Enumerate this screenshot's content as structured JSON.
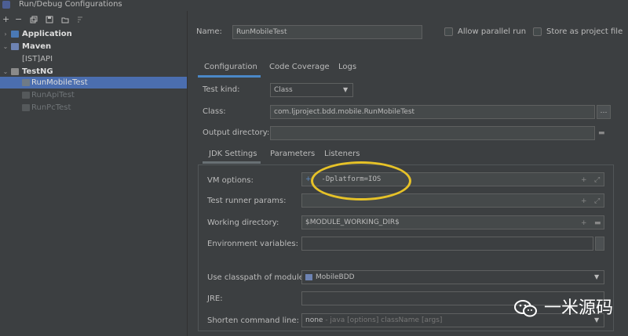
{
  "window": {
    "title": "Run/Debug Configurations"
  },
  "toolbar": {
    "add": "+",
    "remove": "−"
  },
  "tree": {
    "items": [
      {
        "label": "Application",
        "icon": "application-icon",
        "arrow": "›"
      },
      {
        "label": "Maven",
        "icon": "maven-icon",
        "arrow": "⌄"
      },
      {
        "label": "[IST]API",
        "icon": "maven-config-icon",
        "arrow": ""
      },
      {
        "label": "TestNG",
        "icon": "testng-icon",
        "arrow": "⌄"
      },
      {
        "label": "RunMobileTest",
        "icon": "testng-config-icon",
        "arrow": ""
      },
      {
        "label": "RunApiTest",
        "icon": "testng-config-icon",
        "arrow": ""
      },
      {
        "label": "RunPcTest",
        "icon": "testng-config-icon",
        "arrow": ""
      }
    ]
  },
  "form": {
    "name_label": "Name:",
    "name_value": "RunMobileTest",
    "allow_parallel": "Allow parallel run",
    "store_as_file": "Store as project file",
    "tabs": [
      "Configuration",
      "Code Coverage",
      "Logs"
    ],
    "test_kind_label": "Test kind:",
    "test_kind_value": "Class",
    "class_label": "Class:",
    "class_value": "com.ljproject.bdd.mobile.RunMobileTest",
    "output_dir_label": "Output directory:",
    "output_dir_value": "",
    "subtabs": [
      "JDK Settings",
      "Parameters",
      "Listeners"
    ],
    "vm_options_label": "VM options:",
    "vm_options_value": "-Dplatform=IOS",
    "test_runner_params_label": "Test runner params:",
    "working_dir_label": "Working directory:",
    "working_dir_value": "$MODULE_WORKING_DIR$",
    "env_vars_label": "Environment variables:",
    "classpath_label": "Use classpath of module:",
    "classpath_value": "MobileBDD",
    "jre_label": "JRE:",
    "jre_value": "",
    "shorten_label": "Shorten command line:",
    "shorten_value": "none",
    "shorten_hint": "- java [options] className [args]"
  },
  "watermark": {
    "text": "一米源码"
  },
  "colors": {
    "accent": "#4a88c7",
    "selection": "#4b6eaf",
    "highlight_ring": "#e6c228"
  }
}
